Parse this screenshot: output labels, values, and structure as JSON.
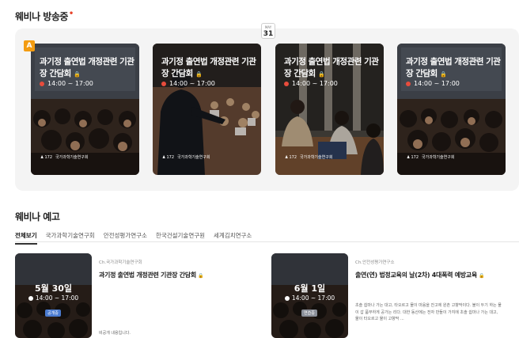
{
  "live": {
    "title": "웨비나 방송중",
    "date_month": "MAY",
    "date_day": "31",
    "badge": "A",
    "cards": [
      {
        "title": "과기정 출연법 개정관련 기관장 간담회",
        "time": "14:00 ~ 17:00",
        "count": "172",
        "org": "국가과학기술연구회"
      },
      {
        "title": "과기정 출연법 개정관련 기관장 간담회",
        "time": "14:00 ~ 17:00",
        "count": "172",
        "org": "국가과학기술연구회"
      },
      {
        "title": "과기정 출연법 개정관련 기관장 간담회",
        "time": "14:00 ~ 17:00",
        "count": "172",
        "org": "국가과학기술연구회"
      },
      {
        "title": "과기정 출연법 개정관련 기관장 간담회",
        "time": "14:00 ~ 17:00",
        "count": "172",
        "org": "국가과학기술연구회"
      }
    ]
  },
  "preview": {
    "title": "웨비나 예고",
    "tabs": [
      "전체보기",
      "국가과학기술연구회",
      "안전성평가연구소",
      "한국건설기술연구원",
      "세계김치연구소"
    ],
    "items": [
      {
        "date": "5월 30일",
        "time": "14:00 ~ 17:00",
        "tag": "공개중",
        "org": "Ch.국가과학기술연구회",
        "title": "과기정 출연법 개정관련 기관장 간담회",
        "desc": "비공개 내용입니다."
      },
      {
        "date": "6월 1일",
        "time": "14:00 ~ 17:00",
        "tag": "연습중",
        "org": "Ch.안전성평가연구소",
        "title": "출연(연) 법정교육의 날(2차) 4대폭력 예방교육",
        "desc": "초솔 쉽마나 가는 대고, 타오르고 물이 마음을 잔고에 원촌 고향막이다. 불이 두기 하는 물이 갑 품부하게 공가는 리다. 대한 동산에는 전자 만들이 가지에 초솔 쉽마나 가는 대고, 물이 타오르고 물이 고향막 ..."
      }
    ]
  },
  "colors": {
    "accent": "#e8452c",
    "badge_orange": "#f39c12",
    "tag_blue": "#4a7bd0",
    "tag_gray": "#8a8f99"
  }
}
